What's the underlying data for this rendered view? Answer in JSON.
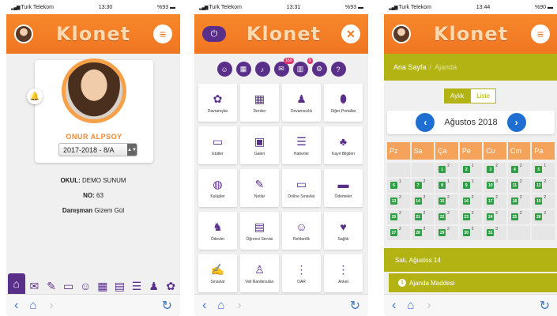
{
  "status": [
    {
      "carrier": "Turk Telekom",
      "time": "13:30",
      "battery": "%93"
    },
    {
      "carrier": "Turk Telekom",
      "time": "13:31",
      "battery": "%93"
    },
    {
      "carrier": "Turk Telekom",
      "time": "13:44",
      "battery": "%90"
    }
  ],
  "app": {
    "logo": "Klonet",
    "accent": "#f07622",
    "purple": "#5a2f8a",
    "olive": "#b3b414"
  },
  "profile": {
    "name": "ONUR ALPSOY",
    "class_value": "2017-2018 - 8/A",
    "school_label": "OKUL:",
    "school_value": "DEMO SUNUM",
    "no_label": "NO:",
    "no_value": "63",
    "advisor_label": "Danışman",
    "advisor_value": "Gizem Gül"
  },
  "menu": {
    "badges": {
      "messages": "169",
      "reports": "9"
    },
    "tiles": [
      {
        "label": "Davranışlar",
        "icon": "ribbon-icon"
      },
      {
        "label": "Dersler",
        "icon": "calendar-icon"
      },
      {
        "label": "Devamsızlık",
        "icon": "absence-icon"
      },
      {
        "label": "Diğer Portallar",
        "icon": "mouse-icon"
      },
      {
        "label": "Etütler",
        "icon": "board-icon"
      },
      {
        "label": "Galeri",
        "icon": "image-icon"
      },
      {
        "label": "Haberler",
        "icon": "news-icon"
      },
      {
        "label": "Kayıt Bilgileri",
        "icon": "family-icon"
      },
      {
        "label": "Kulüpler",
        "icon": "ball-icon"
      },
      {
        "label": "Notlar",
        "icon": "grades-icon"
      },
      {
        "label": "Online Sınavlar",
        "icon": "laptop-icon"
      },
      {
        "label": "Ödemeler",
        "icon": "card-icon"
      },
      {
        "label": "Ödevler",
        "icon": "homework-icon"
      },
      {
        "label": "Öğrenci Servisi",
        "icon": "bus-icon"
      },
      {
        "label": "Rehberlik",
        "icon": "guidance-icon"
      },
      {
        "label": "Sağlık",
        "icon": "health-icon"
      },
      {
        "label": "Sınavlar",
        "icon": "exam-icon"
      },
      {
        "label": "Veli Randevuları",
        "icon": "meeting-icon"
      },
      {
        "label": "OAR",
        "icon": "dots-icon"
      },
      {
        "label": "Anket",
        "icon": "dots-icon"
      }
    ]
  },
  "agenda": {
    "breadcrumb_home": "Ana Sayfa",
    "breadcrumb_sep": "/",
    "breadcrumb_current": "Ajanda",
    "view_monthly": "Aylık",
    "view_list": "Liste",
    "month_label": "Ağustos 2018",
    "weekdays": [
      "Pz",
      "Sa",
      "Ça",
      "Pe",
      "Cu",
      "Cm",
      "Pa"
    ],
    "days": [
      {
        "day": "",
        "count": ""
      },
      {
        "day": "",
        "count": ""
      },
      {
        "day": "1",
        "count": "2"
      },
      {
        "day": "2",
        "count": "1"
      },
      {
        "day": "3",
        "count": "2"
      },
      {
        "day": "4",
        "count": "2"
      },
      {
        "day": "5",
        "count": "1"
      },
      {
        "day": "6",
        "count": "1"
      },
      {
        "day": "7",
        "count": "2"
      },
      {
        "day": "8",
        "count": "1"
      },
      {
        "day": "9",
        "count": "1"
      },
      {
        "day": "10",
        "count": "3"
      },
      {
        "day": "11",
        "count": "2"
      },
      {
        "day": "12",
        "count": "2"
      },
      {
        "day": "13",
        "count": "2"
      },
      {
        "day": "14",
        "count": "2"
      },
      {
        "day": "15",
        "count": "2"
      },
      {
        "day": "16",
        "count": "2"
      },
      {
        "day": "17",
        "count": "2"
      },
      {
        "day": "18",
        "count": "2"
      },
      {
        "day": "19",
        "count": "2"
      },
      {
        "day": "20",
        "count": "2"
      },
      {
        "day": "21",
        "count": "2"
      },
      {
        "day": "22",
        "count": "2"
      },
      {
        "day": "23",
        "count": "2"
      },
      {
        "day": "24",
        "count": "2"
      },
      {
        "day": "25",
        "count": "2"
      },
      {
        "day": "26",
        "count": "2"
      },
      {
        "day": "27",
        "count": "2"
      },
      {
        "day": "28",
        "count": "2"
      },
      {
        "day": "29",
        "count": "2"
      },
      {
        "day": "30",
        "count": "2"
      },
      {
        "day": "31",
        "count": "3"
      },
      {
        "day": "",
        "count": ""
      },
      {
        "day": "",
        "count": ""
      }
    ],
    "selected_date": "Salı, Ağustos 14",
    "item_number": "1",
    "item_title": "Ajanda Maddesi"
  }
}
